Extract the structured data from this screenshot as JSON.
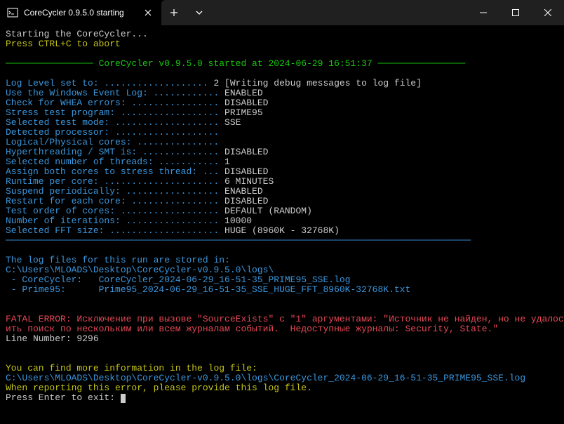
{
  "titlebar": {
    "tab_title": "CoreCycler 0.9.5.0 starting",
    "tab_close": "✕",
    "new_tab": "＋",
    "dropdown": "⌄"
  },
  "term": {
    "l01": "Starting the CoreCycler...",
    "l02": "Press CTRL+C to abort",
    "l03": "",
    "l04": "──────────────── CoreCycler v0.9.5.0 started at 2024-06-29 16:51:37 ────────────────",
    "l05": "",
    "l06a": "Log Level set to: ...................",
    "l06b": " 2 [Writing debug messages to log file]",
    "l07a": "Use the Windows Event Log: ............",
    "l07b": " ENABLED",
    "l08a": "Check for WHEA errors: ................",
    "l08b": " DISABLED",
    "l09a": "Stress test program: ..................",
    "l09b": " PRIME95",
    "l10a": "Selected test mode: ...................",
    "l10b": " SSE",
    "l11a": "Detected processor: ...................",
    "l12a": "Logical/Physical cores: ...............",
    "l13a": "Hyperthreading / SMT is: ..............",
    "l13b": " DISABLED",
    "l14a": "Selected number of threads: ...........",
    "l14b": " 1",
    "l15a": "Assign both cores to stress thread: ...",
    "l15b": " DISABLED",
    "l16a": "Runtime per core: .....................",
    "l16b": " 6 MINUTES",
    "l17a": "Suspend periodically: .................",
    "l17b": " ENABLED",
    "l18a": "Restart for each core: ................",
    "l18b": " DISABLED",
    "l19a": "Test order of cores: ..................",
    "l19b": " DEFAULT (RANDOM)",
    "l20a": "Number of iterations: .................",
    "l20b": " 10000",
    "l21a": "Selected FFT size: ....................",
    "l21b": " HUGE (8960K - 32768K)",
    "l22": "─────────────────────────────────────────────────────────────────────────────────────",
    "l23": "",
    "l24": "The log files for this run are stored in:",
    "l25": "C:\\Users\\MLOADS\\Desktop\\CoreCycler-v0.9.5.0\\logs\\",
    "l26": " - CoreCycler:   CoreCycler_2024-06-29_16-51-35_PRIME95_SSE.log",
    "l27": " - Prime95:      Prime95_2024-06-29_16-51-35_SSE_HUGE_FFT_8960K-32768K.txt",
    "l28": "",
    "l29": "",
    "l30": "FATAL ERROR: Исключение при вызове \"SourceExists\" с \"1\" аргументами: \"Источник не найден, но не удалось выполн",
    "l31": "ить поиск по нескольким или всем журналам событий.  Недоступные журналы: Security, State.\"",
    "l32": "Line Number: 9296",
    "l33": "",
    "l34": "",
    "l35": "You can find more information in the log file:",
    "l36": "C:\\Users\\MLOADS\\Desktop\\CoreCycler-v0.9.5.0\\logs\\CoreCycler_2024-06-29_16-51-35_PRIME95_SSE.log",
    "l37": "When reporting this error, please provide this log file.",
    "l38": "Press Enter to exit: "
  }
}
